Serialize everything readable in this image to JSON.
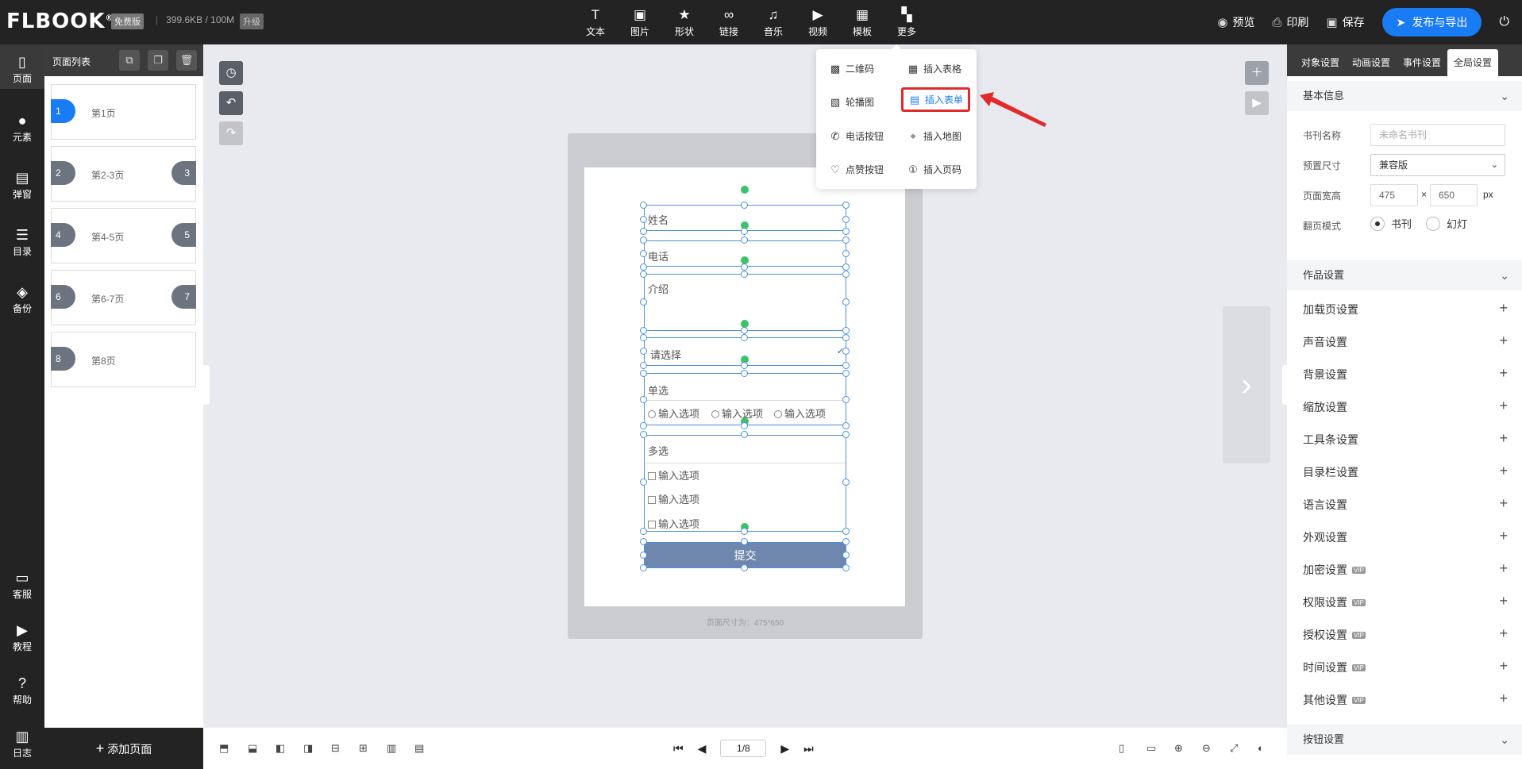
{
  "header": {
    "logo": "FLBOOK",
    "logo_mark": "®",
    "edition_badge": "免费版",
    "storage": "399.6KB / 100M",
    "upgrade_badge": "升级",
    "tools": [
      {
        "icon": "text-icon",
        "glyph": "T",
        "label": "文本"
      },
      {
        "icon": "image-icon",
        "glyph": "▣",
        "label": "图片"
      },
      {
        "icon": "shape-icon",
        "glyph": "★",
        "label": "形状"
      },
      {
        "icon": "link-icon",
        "glyph": "∞",
        "label": "链接"
      },
      {
        "icon": "music-icon",
        "glyph": "♫",
        "label": "音乐"
      },
      {
        "icon": "video-icon",
        "glyph": "▶",
        "label": "视频"
      },
      {
        "icon": "template-icon",
        "glyph": "▦",
        "label": "模板"
      },
      {
        "icon": "more-icon",
        "glyph": "▚",
        "label": "更多"
      }
    ],
    "preview": "预览",
    "print": "印刷",
    "save": "保存",
    "publish": "发布与导出"
  },
  "leftnav": [
    {
      "icon": "page-icon",
      "glyph": "▯",
      "label": "页面"
    },
    {
      "icon": "element-icon",
      "glyph": "●",
      "label": "元素"
    },
    {
      "icon": "popup-icon",
      "glyph": "▤",
      "label": "弹窗"
    },
    {
      "icon": "toc-icon",
      "glyph": "☰",
      "label": "目录"
    },
    {
      "icon": "backup-icon",
      "glyph": "◈",
      "label": "备份"
    },
    {
      "icon": "service-icon",
      "glyph": "▭",
      "label": "客服"
    },
    {
      "icon": "tutorial-icon",
      "glyph": "▶",
      "label": "教程"
    },
    {
      "icon": "help-icon",
      "glyph": "?",
      "label": "帮助"
    },
    {
      "icon": "log-icon",
      "glyph": "▥",
      "label": "日志"
    }
  ],
  "pagelist": {
    "title": "页面列表",
    "pages": [
      {
        "num": "1",
        "num_right": "",
        "label": "第1页",
        "selected": true
      },
      {
        "num": "2",
        "num_right": "3",
        "label": "第2-3页",
        "selected": false
      },
      {
        "num": "4",
        "num_right": "5",
        "label": "第4-5页",
        "selected": false
      },
      {
        "num": "6",
        "num_right": "7",
        "label": "第6-7页",
        "selected": false
      },
      {
        "num": "8",
        "num_right": "",
        "label": "第8页",
        "selected": false
      }
    ],
    "add_page": "添加页面"
  },
  "form": {
    "name": "姓名",
    "phone": "电话",
    "intro": "介绍",
    "select_placeholder": "请选择",
    "radio_title": "单选",
    "radio_options": [
      "输入选项",
      "输入选项",
      "输入选项"
    ],
    "checkbox_title": "多选",
    "checkbox_options": [
      "输入选项",
      "输入选项",
      "输入选项"
    ],
    "submit": "提交"
  },
  "page_size_note": "页面尺寸为：475*650",
  "more_menu": {
    "items": [
      {
        "icon": "qrcode-icon",
        "glyph": "▩",
        "label": "二维码"
      },
      {
        "icon": "table-icon",
        "glyph": "▦",
        "label": "插入表格"
      },
      {
        "icon": "carousel-icon",
        "glyph": "▧",
        "label": "轮播图"
      },
      {
        "icon": "form-icon",
        "glyph": "▤",
        "label": "插入表单"
      },
      {
        "icon": "phone-icon",
        "glyph": "✆",
        "label": "电话按钮"
      },
      {
        "icon": "map-icon",
        "glyph": "⌖",
        "label": "插入地图"
      },
      {
        "icon": "like-icon",
        "glyph": "♡",
        "label": "点赞按钮"
      },
      {
        "icon": "pagenum-icon",
        "glyph": "①",
        "label": "插入页码"
      }
    ]
  },
  "pager": {
    "value": "1/8"
  },
  "rightpanel": {
    "tabs": [
      "对象设置",
      "动画设置",
      "事件设置",
      "全局设置"
    ],
    "basic_info": "基本信息",
    "book_name_label": "书刊名称",
    "book_name_placeholder": "未命名书刊",
    "preset_label": "预置尺寸",
    "preset_value": "兼容版",
    "size_label": "页面宽高",
    "width": "475",
    "times": "×",
    "height": "650",
    "unit": "px",
    "flip_label": "翻页模式",
    "flip_book": "书刊",
    "flip_slide": "幻灯",
    "work_settings": "作品设置",
    "settings": [
      {
        "label": "加载页设置",
        "vip": false
      },
      {
        "label": "声音设置",
        "vip": false
      },
      {
        "label": "背景设置",
        "vip": false
      },
      {
        "label": "缩放设置",
        "vip": false
      },
      {
        "label": "工具条设置",
        "vip": false
      },
      {
        "label": "目录栏设置",
        "vip": false
      },
      {
        "label": "语言设置",
        "vip": false
      },
      {
        "label": "外观设置",
        "vip": false
      },
      {
        "label": "加密设置",
        "vip": true
      },
      {
        "label": "权限设置",
        "vip": true
      },
      {
        "label": "授权设置",
        "vip": true
      },
      {
        "label": "时间设置",
        "vip": true
      },
      {
        "label": "其他设置",
        "vip": true
      }
    ],
    "vip_label": "VIP",
    "button_settings": "按钮设置"
  },
  "colors": {
    "accent": "#1a7cf5",
    "highlight": "#e12b2b",
    "topbar": "#232323"
  }
}
